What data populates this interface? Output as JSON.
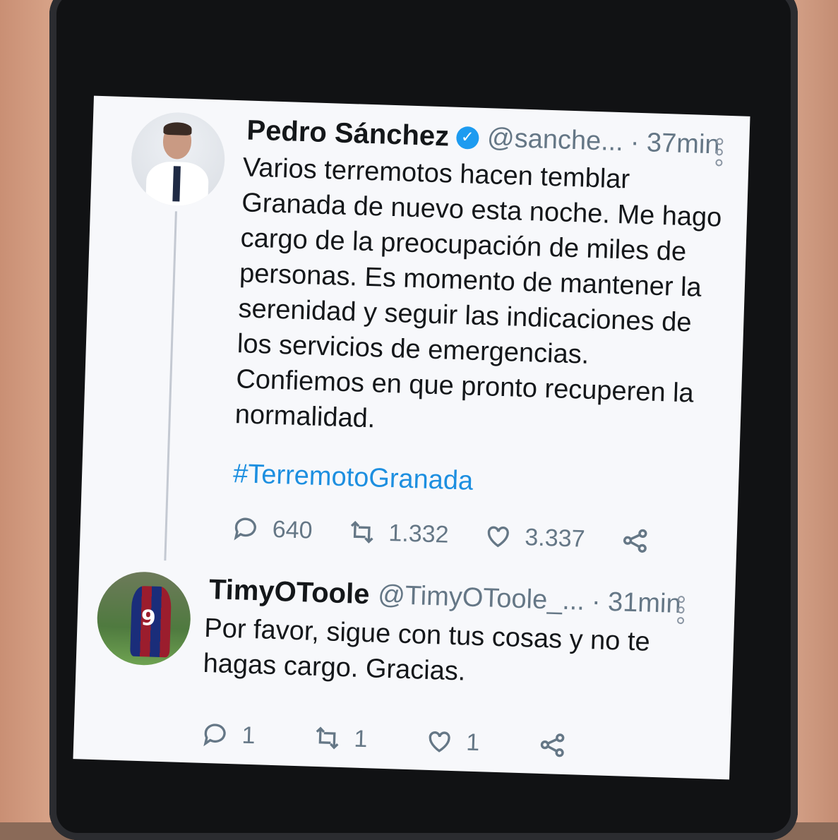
{
  "main_tweet": {
    "display_name": "Pedro Sánchez",
    "handle": "@sanche...",
    "time": "· 37min",
    "text": "Varios terremotos hacen temblar\nGranada de nuevo esta noche. Me hago\ncargo de la preocupación de miles de\npersonas. Es momento de mantener la\nserenidad y seguir las indicaciones de\nlos servicios de emergencias.\nConfiemos en que pronto recuperen la\nnormalidad.",
    "hashtag": "#TerremotoGranada",
    "replies": "640",
    "retweets": "1.332",
    "likes": "3.337"
  },
  "reply_tweet": {
    "display_name": "TimyOToole",
    "handle": "@TimyOToole_...",
    "time": "· 31min",
    "text": "Por favor, sigue con tus cosas y no te\nhagas cargo. Gracias.",
    "replies": "1",
    "retweets": "1",
    "likes": "1"
  },
  "colors": {
    "link": "#1d8fe0",
    "verified": "#1d9bf0",
    "muted": "#657786"
  }
}
